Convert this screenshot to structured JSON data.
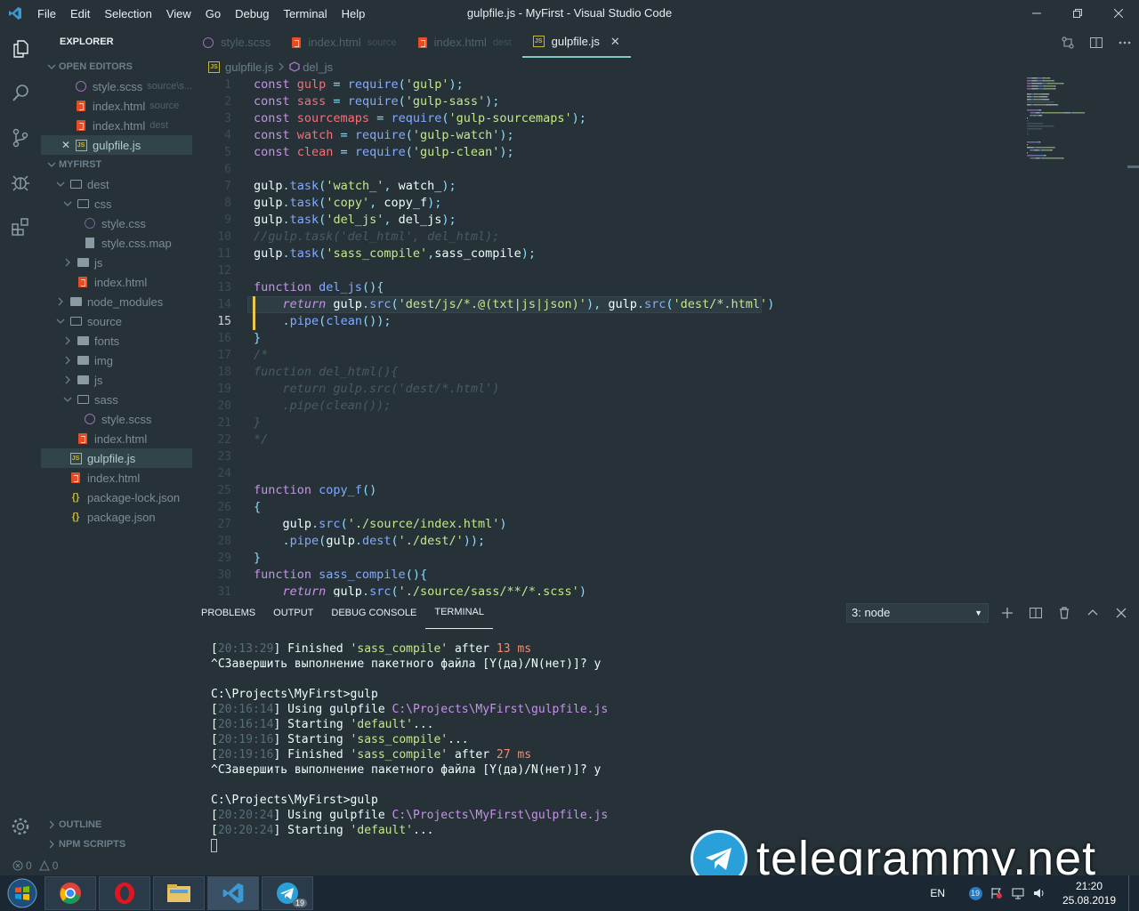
{
  "window": {
    "title": "gulpfile.js - MyFirst - Visual Studio Code",
    "menu": [
      "File",
      "Edit",
      "Selection",
      "View",
      "Go",
      "Debug",
      "Terminal",
      "Help"
    ]
  },
  "sidebar": {
    "title": "EXPLORER",
    "open_editors_label": "OPEN EDITORS",
    "open_editors": [
      {
        "label": "style.scss",
        "desc": "source\\s...",
        "icon": "scss"
      },
      {
        "label": "index.html",
        "desc": "source",
        "icon": "html"
      },
      {
        "label": "index.html",
        "desc": "dest",
        "icon": "html"
      },
      {
        "label": "gulpfile.js",
        "desc": "",
        "icon": "js"
      }
    ],
    "project_label": "MYFIRST",
    "tree": [
      {
        "label": "dest",
        "icon": "folder",
        "depth": 1,
        "twisty": "open"
      },
      {
        "label": "css",
        "icon": "folder",
        "depth": 2,
        "twisty": "open"
      },
      {
        "label": "style.css",
        "icon": "css",
        "depth": 3,
        "twisty": ""
      },
      {
        "label": "style.css.map",
        "icon": "map",
        "depth": 3,
        "twisty": ""
      },
      {
        "label": "js",
        "icon": "folder-solid",
        "depth": 2,
        "twisty": "closed"
      },
      {
        "label": "index.html",
        "icon": "html",
        "depth": 2,
        "twisty": ""
      },
      {
        "label": "node_modules",
        "icon": "folder-solid",
        "depth": 1,
        "twisty": "closed"
      },
      {
        "label": "source",
        "icon": "folder",
        "depth": 1,
        "twisty": "open"
      },
      {
        "label": "fonts",
        "icon": "folder-solid",
        "depth": 2,
        "twisty": "closed"
      },
      {
        "label": "img",
        "icon": "folder-solid",
        "depth": 2,
        "twisty": "closed"
      },
      {
        "label": "js",
        "icon": "folder-solid",
        "depth": 2,
        "twisty": "closed"
      },
      {
        "label": "sass",
        "icon": "folder",
        "depth": 2,
        "twisty": "open"
      },
      {
        "label": "style.scss",
        "icon": "scss",
        "depth": 3,
        "twisty": ""
      },
      {
        "label": "index.html",
        "icon": "html",
        "depth": 2,
        "twisty": ""
      },
      {
        "label": "gulpfile.js",
        "icon": "js",
        "depth": 1,
        "twisty": "",
        "selected": true
      },
      {
        "label": "index.html",
        "icon": "html",
        "depth": 1,
        "twisty": ""
      },
      {
        "label": "package-lock.json",
        "icon": "json",
        "depth": 1,
        "twisty": ""
      },
      {
        "label": "package.json",
        "icon": "json",
        "depth": 1,
        "twisty": ""
      }
    ],
    "outline_label": "OUTLINE",
    "npm_label": "NPM SCRIPTS"
  },
  "tabs": [
    {
      "label": "style.scss",
      "desc": "",
      "icon": "scss",
      "active": false
    },
    {
      "label": "index.html",
      "desc": "source",
      "icon": "html",
      "active": false
    },
    {
      "label": "index.html",
      "desc": "dest",
      "icon": "html",
      "active": false
    },
    {
      "label": "gulpfile.js",
      "desc": "",
      "icon": "js",
      "active": true
    }
  ],
  "breadcrumb": {
    "file": "gulpfile.js",
    "symbol": "del_js"
  },
  "editor": {
    "current_line": 15,
    "lines": [
      [
        [
          "kw",
          "const "
        ],
        [
          "var",
          "gulp"
        ],
        [
          "pn",
          " = "
        ],
        [
          "fn",
          "require"
        ],
        [
          "pn",
          "("
        ],
        [
          "str",
          "'gulp'"
        ],
        [
          "pn",
          ");"
        ]
      ],
      [
        [
          "kw",
          "const "
        ],
        [
          "var",
          "sass"
        ],
        [
          "pn",
          " = "
        ],
        [
          "fn",
          "require"
        ],
        [
          "pn",
          "("
        ],
        [
          "str",
          "'gulp-sass'"
        ],
        [
          "pn",
          ");"
        ]
      ],
      [
        [
          "kw",
          "const "
        ],
        [
          "var",
          "sourcemaps"
        ],
        [
          "pn",
          " = "
        ],
        [
          "fn",
          "require"
        ],
        [
          "pn",
          "("
        ],
        [
          "str",
          "'gulp-sourcemaps'"
        ],
        [
          "pn",
          ");"
        ]
      ],
      [
        [
          "kw",
          "const "
        ],
        [
          "var",
          "watch"
        ],
        [
          "pn",
          " = "
        ],
        [
          "fn",
          "require"
        ],
        [
          "pn",
          "("
        ],
        [
          "str",
          "'gulp-watch'"
        ],
        [
          "pn",
          ");"
        ]
      ],
      [
        [
          "kw",
          "const "
        ],
        [
          "var",
          "clean"
        ],
        [
          "pn",
          " = "
        ],
        [
          "fn",
          "require"
        ],
        [
          "pn",
          "("
        ],
        [
          "str",
          "'gulp-clean'"
        ],
        [
          "pn",
          ");"
        ]
      ],
      [],
      [
        [
          "",
          "gulp"
        ],
        [
          "pn",
          "."
        ],
        [
          "fn",
          "task"
        ],
        [
          "pn",
          "("
        ],
        [
          "str",
          "'watch_'"
        ],
        [
          "pn",
          ", "
        ],
        [
          "",
          "watch_"
        ],
        [
          "pn",
          ");"
        ]
      ],
      [
        [
          "",
          "gulp"
        ],
        [
          "pn",
          "."
        ],
        [
          "fn",
          "task"
        ],
        [
          "pn",
          "("
        ],
        [
          "str",
          "'copy'"
        ],
        [
          "pn",
          ", "
        ],
        [
          "",
          "copy_f"
        ],
        [
          "pn",
          ");"
        ]
      ],
      [
        [
          "",
          "gulp"
        ],
        [
          "pn",
          "."
        ],
        [
          "fn",
          "task"
        ],
        [
          "pn",
          "("
        ],
        [
          "str",
          "'del_js'"
        ],
        [
          "pn",
          ", "
        ],
        [
          "",
          "del_js"
        ],
        [
          "pn",
          ");"
        ]
      ],
      [
        [
          "cm",
          "//gulp.task('del_html', del_html);"
        ]
      ],
      [
        [
          "",
          "gulp"
        ],
        [
          "pn",
          "."
        ],
        [
          "fn",
          "task"
        ],
        [
          "pn",
          "("
        ],
        [
          "str",
          "'sass_compile'"
        ],
        [
          "pn",
          ","
        ],
        [
          "",
          "sass_compile"
        ],
        [
          "pn",
          ");"
        ]
      ],
      [],
      [
        [
          "kw",
          "function "
        ],
        [
          "fn",
          "del_js"
        ],
        [
          "pn",
          "(){"
        ]
      ],
      [
        [
          "",
          "    "
        ],
        [
          "kw it",
          "return "
        ],
        [
          "",
          "gulp"
        ],
        [
          "pn",
          "."
        ],
        [
          "fn",
          "src"
        ],
        [
          "pn",
          "("
        ],
        [
          "str",
          "'dest/js/*.@(txt|js|json)'"
        ],
        [
          "pn",
          "), "
        ],
        [
          "",
          "gulp"
        ],
        [
          "pn",
          "."
        ],
        [
          "fn",
          "src"
        ],
        [
          "pn",
          "("
        ],
        [
          "str",
          "'dest/*.html'"
        ],
        [
          "pn",
          ")"
        ]
      ],
      [
        [
          "",
          "    "
        ],
        [
          "pn",
          "."
        ],
        [
          "fn",
          "pipe"
        ],
        [
          "pn",
          "("
        ],
        [
          "fn",
          "clean"
        ],
        [
          "pn",
          "());"
        ]
      ],
      [
        [
          "pn",
          "}"
        ]
      ],
      [
        [
          "cm",
          "/*"
        ]
      ],
      [
        [
          "cm",
          "function del_html(){"
        ]
      ],
      [
        [
          "cm",
          "    return gulp.src('dest/*.html')"
        ]
      ],
      [
        [
          "cm",
          "    .pipe(clean());"
        ]
      ],
      [
        [
          "cm",
          "}"
        ]
      ],
      [
        [
          "cm",
          "*/"
        ]
      ],
      [],
      [],
      [
        [
          "kw",
          "function "
        ],
        [
          "fn",
          "copy_f"
        ],
        [
          "pn",
          "()"
        ]
      ],
      [
        [
          "pn",
          "{"
        ]
      ],
      [
        [
          "",
          "    gulp"
        ],
        [
          "pn",
          "."
        ],
        [
          "fn",
          "src"
        ],
        [
          "pn",
          "("
        ],
        [
          "str",
          "'./source/index.html'"
        ],
        [
          "pn",
          ")"
        ]
      ],
      [
        [
          "",
          "    "
        ],
        [
          "pn",
          "."
        ],
        [
          "fn",
          "pipe"
        ],
        [
          "pn",
          "("
        ],
        [
          "",
          "gulp"
        ],
        [
          "pn",
          "."
        ],
        [
          "fn",
          "dest"
        ],
        [
          "pn",
          "("
        ],
        [
          "str",
          "'./dest/'"
        ],
        [
          "pn",
          "));"
        ]
      ],
      [
        [
          "pn",
          "}"
        ]
      ],
      [
        [
          "kw",
          "function "
        ],
        [
          "fn",
          "sass_compile"
        ],
        [
          "pn",
          "(){"
        ]
      ],
      [
        [
          "",
          "    "
        ],
        [
          "kw it",
          "return "
        ],
        [
          "",
          "gulp"
        ],
        [
          "pn",
          "."
        ],
        [
          "fn",
          "src"
        ],
        [
          "pn",
          "("
        ],
        [
          "str",
          "'./source/sass/**/*.scss'"
        ],
        [
          "pn",
          ")"
        ]
      ]
    ]
  },
  "panel": {
    "tabs": [
      "PROBLEMS",
      "OUTPUT",
      "DEBUG CONSOLE",
      "TERMINAL"
    ],
    "active_tab": "TERMINAL",
    "terminal_selected": "3: node",
    "terminal_lines": [
      [
        [
          "",
          "["
        ],
        [
          "t-ts",
          "20:13:29"
        ],
        [
          "",
          "] Finished "
        ],
        [
          "t-str",
          "'sass_compile'"
        ],
        [
          "",
          " after "
        ],
        [
          "t-num",
          "13"
        ],
        [
          "t-num",
          " ms"
        ]
      ],
      [
        [
          "",
          "^CЗавершить выполнение пакетного файла [Y(да)/N(нет)]? y"
        ]
      ],
      [],
      [
        [
          "",
          "C:\\Projects\\MyFirst>gulp"
        ]
      ],
      [
        [
          "",
          "["
        ],
        [
          "t-ts",
          "20:16:14"
        ],
        [
          "",
          "] Using gulpfile "
        ],
        [
          "t-path",
          "C:\\Projects\\MyFirst\\gulpfile.js"
        ]
      ],
      [
        [
          "",
          "["
        ],
        [
          "t-ts",
          "20:16:14"
        ],
        [
          "",
          "] Starting "
        ],
        [
          "t-str",
          "'default'"
        ],
        [
          "",
          "..."
        ]
      ],
      [
        [
          "",
          "["
        ],
        [
          "t-ts",
          "20:19:16"
        ],
        [
          "",
          "] Starting "
        ],
        [
          "t-str",
          "'sass_compile'"
        ],
        [
          "",
          "..."
        ]
      ],
      [
        [
          "",
          "["
        ],
        [
          "t-ts",
          "20:19:16"
        ],
        [
          "",
          "] Finished "
        ],
        [
          "t-str",
          "'sass_compile'"
        ],
        [
          "",
          " after "
        ],
        [
          "t-num",
          "27"
        ],
        [
          "t-num",
          " ms"
        ]
      ],
      [
        [
          "",
          "^CЗавершить выполнение пакетного файла [Y(да)/N(нет)]? y"
        ]
      ],
      [],
      [
        [
          "",
          "C:\\Projects\\MyFirst>gulp"
        ]
      ],
      [
        [
          "",
          "["
        ],
        [
          "t-ts",
          "20:20:24"
        ],
        [
          "",
          "] Using gulpfile "
        ],
        [
          "t-path",
          "C:\\Projects\\MyFirst\\gulpfile.js"
        ]
      ],
      [
        [
          "",
          "["
        ],
        [
          "t-ts",
          "20:20:24"
        ],
        [
          "",
          "] Starting "
        ],
        [
          "t-str",
          "'default'"
        ],
        [
          "",
          "..."
        ]
      ]
    ]
  },
  "statusbar": {
    "errors": "0",
    "warnings": "0"
  },
  "watermark": {
    "text": "telegrammy.net"
  },
  "taskbar": {
    "apps": [
      "chrome",
      "opera",
      "explorer",
      "vscode",
      "telegram"
    ],
    "telegram_badge": "19",
    "lang": "EN",
    "tray_badge": "19",
    "time": "21:20",
    "date": "25.08.2019"
  },
  "colors": {
    "accent": "#80cbc4",
    "background": "#263238",
    "keyword": "#c792ea",
    "string": "#c3e88d",
    "function": "#82aaff",
    "variable": "#f07178"
  }
}
